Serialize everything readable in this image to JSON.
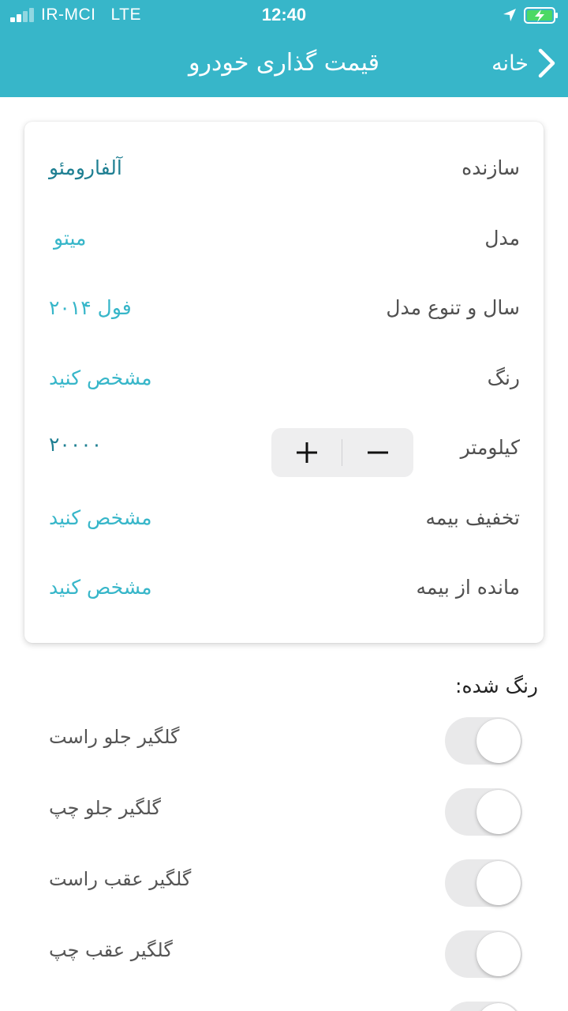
{
  "status_bar": {
    "carrier": "IR-MCI   LTE",
    "time": "12:40"
  },
  "nav": {
    "back_label": "خانه",
    "title": "قیمت گذاری خودرو"
  },
  "fields": [
    {
      "label": "سازنده",
      "value": "آلفارومئو"
    },
    {
      "label": "مدل",
      "value": "میتو"
    },
    {
      "label": "سال و تنوع مدل",
      "value": "فول  ۲۰۱۴"
    },
    {
      "label": "رنگ",
      "value": "مشخص کنید"
    },
    {
      "label": "کیلومتر",
      "value": "۲۰۰۰۰"
    },
    {
      "label": "تخفیف بیمه",
      "value": "مشخص کنید"
    },
    {
      "label": "مانده از بیمه",
      "value": "مشخص کنید"
    }
  ],
  "stepper": {
    "decrement_icon": "minus-icon",
    "increment_icon": "plus-icon"
  },
  "painted_section": {
    "title": "رنگ شده:",
    "items": [
      {
        "label": "گلگیر جلو راست",
        "on": false
      },
      {
        "label": "گلگیر جلو چپ",
        "on": false
      },
      {
        "label": "گلگیر عقب راست",
        "on": false
      },
      {
        "label": "گلگیر عقب چپ",
        "on": false
      }
    ]
  },
  "colors": {
    "header": "#37b6c9",
    "accent": "#37b6c9",
    "accent_dark": "#1e7f92",
    "battery": "#4cd964"
  }
}
